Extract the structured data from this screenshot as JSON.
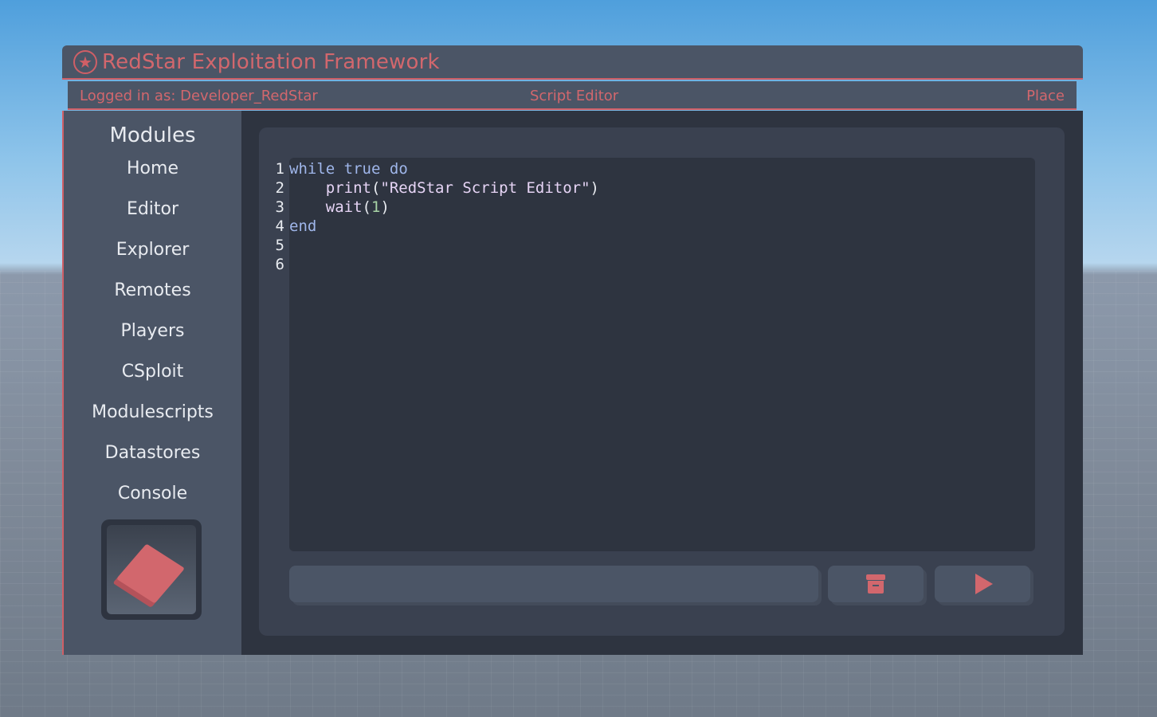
{
  "app": {
    "title": "RedStar Exploitation Framework",
    "logo_icon": "star-circle-icon"
  },
  "infobar": {
    "logged_in": "Logged in as: Developer_RedStar",
    "section": "Script Editor",
    "place": "Place"
  },
  "sidebar": {
    "heading": "Modules",
    "items": [
      {
        "label": "Home"
      },
      {
        "label": "Editor"
      },
      {
        "label": "Explorer"
      },
      {
        "label": "Remotes"
      },
      {
        "label": "Players"
      },
      {
        "label": "CSploit"
      },
      {
        "label": "Modulescripts"
      },
      {
        "label": "Datastores"
      },
      {
        "label": "Console"
      }
    ],
    "thumbnail_icon": "book-icon"
  },
  "editor": {
    "line_numbers": [
      "1",
      "2",
      "3",
      "4",
      "5",
      "6"
    ],
    "lines": {
      "l1_kw1": "while",
      "l1_kw2": "true",
      "l1_kw3": "do",
      "l2_indent": "    ",
      "l2_fn": "print",
      "l2_open": "(",
      "l2_str": "\"RedStar Script Editor\"",
      "l2_close": ")",
      "l3_indent": "    ",
      "l3_fn": "wait",
      "l3_open": "(",
      "l3_num": "1",
      "l3_close": ")",
      "l4_kw": "end"
    }
  },
  "actions": {
    "script_name_value": "",
    "save_icon": "archive-icon",
    "run_icon": "play-icon"
  },
  "colors": {
    "accent": "#cf5f66",
    "panel": "#4b5566",
    "editor_bg": "#2e3440",
    "keyword": "#9fb6ea"
  }
}
